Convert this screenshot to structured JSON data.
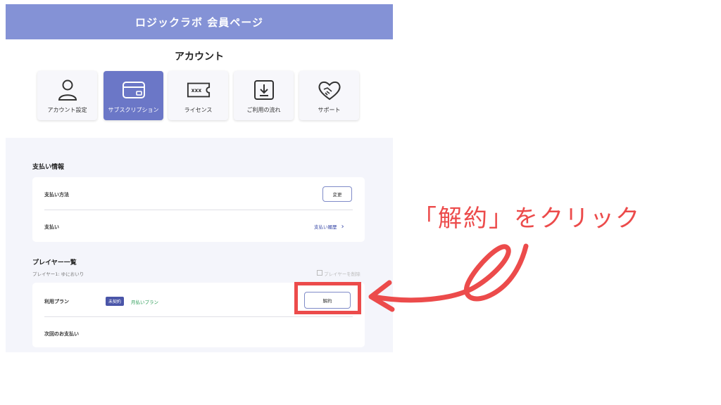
{
  "header": {
    "title": "ロジックラボ 会員ページ"
  },
  "account": {
    "title": "アカウント"
  },
  "tiles": [
    {
      "label": "アカウント設定",
      "icon": "user-icon",
      "active": false
    },
    {
      "label": "サブスクリプション",
      "icon": "credit-card-icon",
      "active": true
    },
    {
      "label": "ライセンス",
      "icon": "license-ticket-icon",
      "active": false
    },
    {
      "label": "ご利用の流れ",
      "icon": "download-icon",
      "active": false
    },
    {
      "label": "サポート",
      "icon": "handshake-heart-icon",
      "active": false
    }
  ],
  "payment": {
    "heading": "支払い情報",
    "method_label": "支払い方法",
    "change_label": "変更",
    "payment_label": "支払い",
    "history_link": "支払い履歴",
    "history_chevron": "›"
  },
  "players": {
    "heading": "プレイヤー一覧",
    "player_label": "プレイヤー1: ゆにおいり",
    "add_player": "プレイヤーを削除",
    "plan_label": "利用プラン",
    "badge": "未契約",
    "plan_name": "月払いプラン",
    "cancel_label": "解約",
    "next_payment_label": "次回のお支払い"
  },
  "annotation": {
    "callout": "「解約」をクリック"
  },
  "colors": {
    "header": "#8492d6",
    "active_tile": "#6b77c7",
    "callout": "#ec4b4b",
    "plan_green": "#2a9b55"
  }
}
